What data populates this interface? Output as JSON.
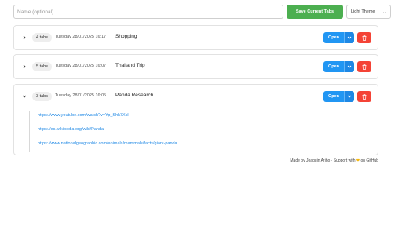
{
  "toolbar": {
    "name_placeholder": "Name (optional)",
    "save_label": "Save Current Tabs",
    "theme_selected": "Light Theme"
  },
  "sessions": [
    {
      "tab_count": "4 tabs",
      "date": "Tuesday 28/01/2025 16:17",
      "title": "Shopping",
      "expanded": false,
      "open_label": "Open"
    },
    {
      "tab_count": "5 tabs",
      "date": "Tuesday 28/01/2025 16:07",
      "title": "Thailand Trip",
      "expanded": false,
      "open_label": "Open"
    },
    {
      "tab_count": "3 tabs",
      "date": "Tuesday 28/01/2025 16:05",
      "title": "Panda Research",
      "expanded": true,
      "open_label": "Open",
      "links": [
        "https://www.youtube.com/watch?v=Yp_Shk7Xcl",
        "https://es.wikipedia.org/wiki/Panda",
        "https://www.nationalgeographic.com/animals/mammals/facts/giant-panda"
      ]
    }
  ],
  "footer": {
    "text_before": "Made by Joaquin Ariño · Support with",
    "heart": "❤",
    "text_after": "on GitHub"
  },
  "colors": {
    "save": "#4caf50",
    "open": "#2196f3",
    "delete": "#f44336",
    "link": "#1e88e5"
  }
}
